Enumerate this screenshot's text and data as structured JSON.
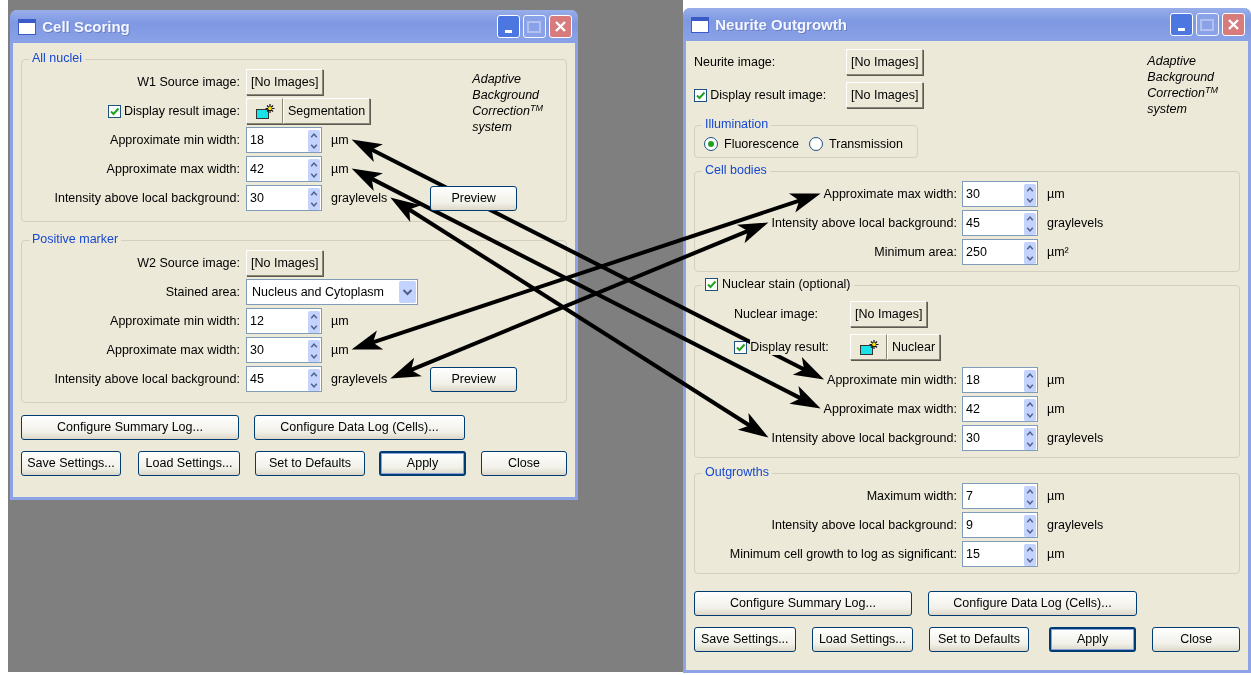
{
  "windows": [
    {
      "title": "Cell Scoring",
      "logo": "*Adaptive Background Correction*$^{TM}$ *system*",
      "groups": [
        {
          "legend": "All nuclei",
          "rows": [
            {
              "kind": "source",
              "label": "W1 Source image:",
              "button": "[No Images]"
            },
            {
              "kind": "result",
              "label": "Display result image:",
              "checked": true,
              "picker": true,
              "button": "Segmentation"
            },
            {
              "kind": "spin",
              "label": "Approximate min width:",
              "value": "18",
              "unit": "µm"
            },
            {
              "kind": "spin",
              "label": "Approximate max width:",
              "value": "42",
              "unit": "µm"
            },
            {
              "kind": "spin",
              "label": "Intensity above local background:",
              "value": "30",
              "unit": "graylevels",
              "button": "Preview"
            }
          ]
        },
        {
          "legend": "Positive marker",
          "rows": [
            {
              "kind": "source",
              "label": "W2 Source image:",
              "button": "[No Images]"
            },
            {
              "kind": "dropdown",
              "label": "Stained area:",
              "value": "Nucleus and Cytoplasm"
            },
            {
              "kind": "spin",
              "label": "Approximate min width:",
              "value": "12",
              "unit": "µm"
            },
            {
              "kind": "spin",
              "label": "Approximate max width:",
              "value": "30",
              "unit": "µm"
            },
            {
              "kind": "spin",
              "label": "Intensity above local background:",
              "value": "45",
              "unit": "graylevels",
              "button": "Preview"
            }
          ]
        }
      ],
      "buttons": [
        [
          {
            "label": "Configure Summary Log...",
            "default": false
          },
          {
            "label": "Configure Data Log (Cells)...",
            "default": false
          }
        ],
        [
          {
            "label": "Save Settings...",
            "default": false
          },
          {
            "label": "Load Settings...",
            "default": false
          },
          {
            "label": "Set to Defaults",
            "default": false
          },
          {
            "label": "Apply",
            "default": true
          },
          {
            "label": "Close",
            "default": false
          }
        ]
      ]
    },
    {
      "title": "Neurite Outgrowth",
      "logo": "*Adaptive Background Correction*$^{TM}$ *system*",
      "top_rows": [
        {
          "kind": "source",
          "label": "Neurite image:",
          "button": "[No Images]"
        },
        {
          "kind": "result",
          "label": "Display result image:",
          "checked": true,
          "picker": false,
          "button": "[No Images]"
        }
      ],
      "groups": [
        {
          "legend": "Illumination",
          "rows": [
            {
              "kind": "radios",
              "options": [
                {
                  "label": "Fluorescence",
                  "selected": true
                },
                {
                  "label": "Transmission",
                  "selected": false
                }
              ]
            }
          ]
        },
        {
          "legend": "Cell bodies",
          "rows": [
            {
              "kind": "spin",
              "label": "Approximate max width:",
              "value": "30",
              "unit": "µm"
            },
            {
              "kind": "spin",
              "label": "Intensity above local background:",
              "value": "45",
              "unit": "graylevels"
            },
            {
              "kind": "spin",
              "label": "Minimum area:",
              "value": "250",
              "unit": "µm²"
            }
          ]
        },
        {
          "legend": "Nuclear stain (optional)",
          "checked": true,
          "rows": [
            {
              "kind": "source",
              "label": "Nuclear image:",
              "button": "[No Images]"
            },
            {
              "kind": "result",
              "label": "Display result:",
              "checked": true,
              "picker": true,
              "button": "Nuclear"
            },
            {
              "kind": "spin",
              "label": "Approximate min width:",
              "value": "18",
              "unit": "µm"
            },
            {
              "kind": "spin",
              "label": "Approximate max width:",
              "value": "42",
              "unit": "µm"
            },
            {
              "kind": "spin",
              "label": "Intensity above local background:",
              "value": "30",
              "unit": "graylevels"
            }
          ]
        },
        {
          "legend": "Outgrowths",
          "rows": [
            {
              "kind": "spin",
              "label": "Maximum width:",
              "value": "7",
              "unit": "µm"
            },
            {
              "kind": "spin",
              "label": "Intensity above local background:",
              "value": "9",
              "unit": "graylevels"
            },
            {
              "kind": "spin",
              "label": "Minimum cell growth to log as significant:",
              "value": "15",
              "unit": "µm"
            }
          ]
        }
      ],
      "buttons": [
        [
          {
            "label": "Configure Summary Log...",
            "default": false
          },
          {
            "label": "Configure Data Log (Cells)...",
            "default": false
          }
        ],
        [
          {
            "label": "Save Settings...",
            "default": false
          },
          {
            "label": "Load Settings...",
            "default": false
          },
          {
            "label": "Set to Defaults",
            "default": false
          },
          {
            "label": "Apply",
            "default": true
          },
          {
            "label": "Close",
            "default": false
          }
        ]
      ]
    }
  ]
}
